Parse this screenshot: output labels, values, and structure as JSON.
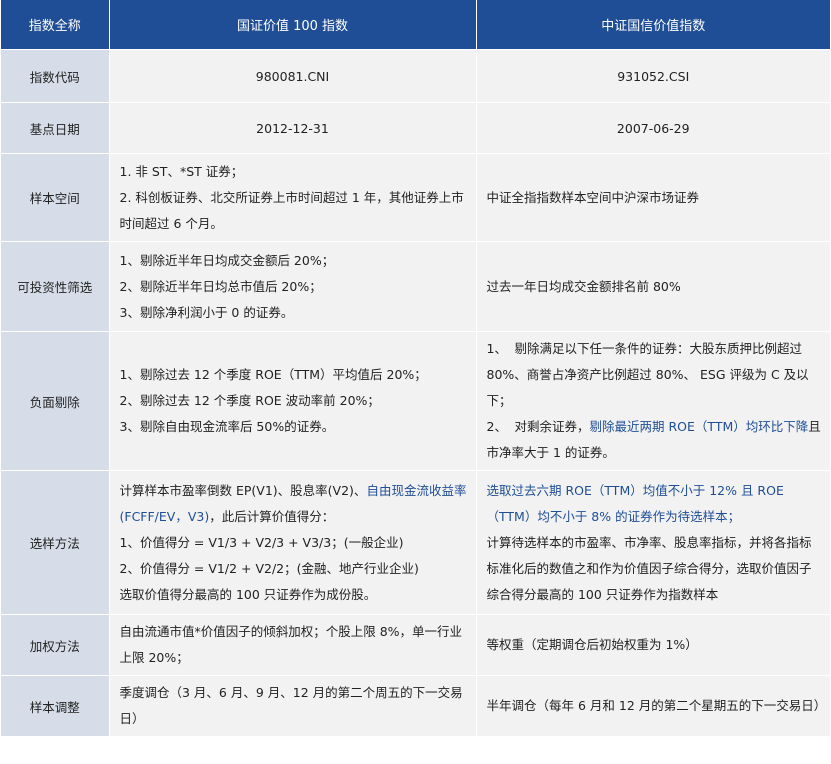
{
  "header": {
    "col1": "指数全称",
    "col2": "国证价值 100 指数",
    "col3": "中证国信价值指数"
  },
  "rows": {
    "code": {
      "label": "指数代码",
      "a": "980081.CNI",
      "b": "931052.CSI"
    },
    "base_date": {
      "label": "基点日期",
      "a": "2012-12-31",
      "b": "2007-06-29"
    },
    "universe": {
      "label": "样本空间",
      "a1": "1. 非 ST、*ST 证券；",
      "a2": "2. 科创板证券、北交所证券上市时间超过 1 年，其他证券上市时间超过 6 个月。",
      "b": "中证全指指数样本空间中沪深市场证券"
    },
    "investability": {
      "label": "可投资性筛选",
      "a1": "1、剔除近半年日均成交金额后 20%；",
      "a2": "2、剔除近半年日均总市值后 20%；",
      "a3": "3、剔除净利润小于 0 的证券。",
      "b": "过去一年日均成交金额排名前 80%"
    },
    "negative": {
      "label": "负面剔除",
      "a1": "1、剔除过去 12 个季度 ROE（TTM）平均值后 20%；",
      "a2": "2、剔除过去 12 个季度 ROE 波动率前 20%；",
      "a3": "3、剔除自由现金流率后 50%的证券。",
      "b1_num": "1、",
      "b1": "剔除满足以下任一条件的证券：大股东质押比例超过 80%、商誉占净资产比例超过 80%、 ESG 评级为 C 及以下；",
      "b2_num": "2、",
      "b2_plain": "对剩余证券，",
      "b2_blue": "剔除最近两期 ROE（TTM）均环比下降",
      "b2_rest": "且市净率大于 1 的证券。"
    },
    "selection": {
      "label": "选样方法",
      "a1_plain": "计算样本市盈率倒数 EP(V1)、股息率(V2)、",
      "a1_blue": "自由现金流收益率(FCFF/EV，V3)",
      "a1_rest": "，此后计算价值得分：",
      "a2": "1、价值得分 = V1/3 + V2/3 + V3/3；(一般企业)",
      "a3": "2、价值得分 = V1/2 + V2/2；(金融、地产行业企业)",
      "a4": "选取价值得分最高的 100 只证券作为成份股。",
      "b1_blue": "选取过去六期 ROE（TTM）均值不小于 12% 且 ROE（TTM）均不小于 8% 的证券作为待选样本；",
      "b2": "计算待选样本的市盈率、市净率、股息率指标，并将各指标标准化后的数值之和作为价值因子综合得分，选取价值因子综合得分最高的 100 只证券作为指数样本"
    },
    "weighting": {
      "label": "加权方法",
      "a": "自由流通市值*价值因子的倾斜加权；个股上限 8%，单一行业上限 20%；",
      "b": "等权重（定期调仓后初始权重为 1%）"
    },
    "rebalance": {
      "label": "样本调整",
      "a": "季度调仓（3 月、6 月、9 月、12 月的第二个周五的下一交易日）",
      "b": "半年调仓（每年 6 月和 12 月的第二个星期五的下一交易日）"
    }
  },
  "colors": {
    "header_bg": "#1f4e96",
    "label_bg": "#d6dde8",
    "cell_bg": "#f2f2f2",
    "highlight": "#1f4e96"
  }
}
